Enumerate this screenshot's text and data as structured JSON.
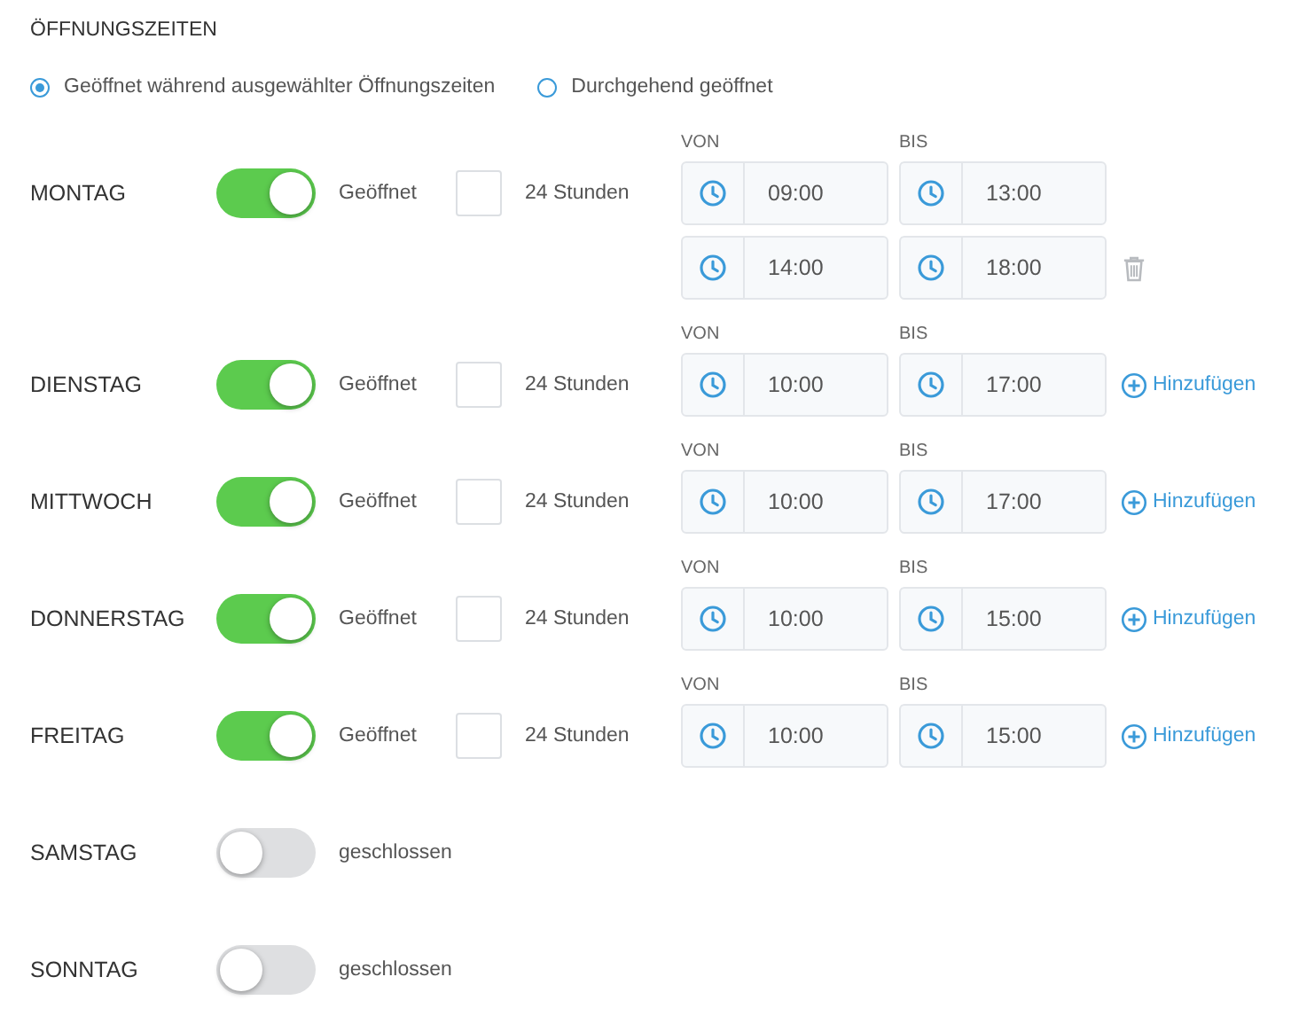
{
  "title": "ÖFFNUNGSZEITEN",
  "modes": [
    {
      "label": "Geöffnet während ausgewählter Öffnungszeiten",
      "selected": true
    },
    {
      "label": "Durchgehend geöffnet",
      "selected": false
    }
  ],
  "days": [
    {
      "name": "MONTAG",
      "open": true,
      "status": "Geöffnet",
      "all_day": false,
      "all_day_label": "24 Stunden",
      "from_label": "VON",
      "to_label": "BIS",
      "slots": [
        {
          "from": "09:00",
          "to": "13:00"
        },
        {
          "from": "14:00",
          "to": "18:00",
          "action": {
            "kind": "delete"
          }
        }
      ]
    },
    {
      "name": "DIENSTAG",
      "open": true,
      "status": "Geöffnet",
      "all_day": false,
      "all_day_label": "24 Stunden",
      "from_label": "VON",
      "to_label": "BIS",
      "slots": [
        {
          "from": "10:00",
          "to": "17:00",
          "action": {
            "kind": "add",
            "label": "Hinzufügen"
          }
        }
      ]
    },
    {
      "name": "MITTWOCH",
      "open": true,
      "status": "Geöffnet",
      "all_day": false,
      "all_day_label": "24 Stunden",
      "from_label": "VON",
      "to_label": "BIS",
      "slots": [
        {
          "from": "10:00",
          "to": "17:00",
          "action": {
            "kind": "add",
            "label": "Hinzufügen"
          }
        }
      ]
    },
    {
      "name": "DONNERSTAG",
      "open": true,
      "status": "Geöffnet",
      "all_day": false,
      "all_day_label": "24 Stunden",
      "from_label": "VON",
      "to_label": "BIS",
      "slots": [
        {
          "from": "10:00",
          "to": "15:00",
          "action": {
            "kind": "add",
            "label": "Hinzufügen"
          }
        }
      ]
    },
    {
      "name": "FREITAG",
      "open": true,
      "status": "Geöffnet",
      "all_day": false,
      "all_day_label": "24 Stunden",
      "from_label": "VON",
      "to_label": "BIS",
      "slots": [
        {
          "from": "10:00",
          "to": "15:00",
          "action": {
            "kind": "add",
            "label": "Hinzufügen"
          }
        }
      ]
    },
    {
      "name": "SAMSTAG",
      "open": false,
      "status": "geschlossen"
    },
    {
      "name": "SONNTAG",
      "open": false,
      "status": "geschlossen"
    }
  ]
}
